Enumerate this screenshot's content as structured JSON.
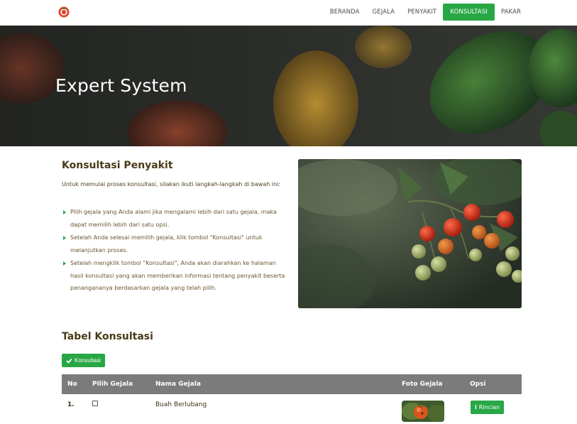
{
  "nav": {
    "items": [
      {
        "label": "BERANDA",
        "active": false
      },
      {
        "label": "GEJALA",
        "active": false
      },
      {
        "label": "PENYAKIT",
        "active": false
      },
      {
        "label": "KONSULTASI",
        "active": true
      },
      {
        "label": "PAKAR",
        "active": false
      }
    ]
  },
  "hero": {
    "title": "Expert System"
  },
  "konsultasi": {
    "title": "Konsultasi Penyakit",
    "intro": "Untuk memulai proses konsultasi, silakan ikuti langkah-langkah di bawah ini:",
    "steps": [
      "Pilih gejala yang Anda alami jika mengalami lebih dari satu gejala, maka dapat memilih lebih dari satu opsi.",
      "Setelah Anda selesai memilih gejala, klik tombol \"Konsultasi\" untuk melanjutkan proses.",
      "Setelah mengklik tombol \"Konsultasi\", Anda akan diarahkan ke halaman hasil konsultasi yang akan memberikan informasi tentang penyakit beserta penangananya berdasarkan gejala yang telah pilih."
    ]
  },
  "table": {
    "title": "Tabel Konsultasi",
    "button_label": "Konsultasi",
    "headers": [
      "No",
      "Pilih Gejala",
      "Nama Gejala",
      "Foto Gejala",
      "Opsi"
    ],
    "rows": [
      {
        "no": "1.",
        "checked": false,
        "nama": "Buah Berlubang",
        "opsi_label": "Rincian"
      }
    ]
  },
  "colors": {
    "accent": "#28a745",
    "table_header": "#7b7b7b",
    "heading": "#4a3a18"
  },
  "icons": {
    "logo": "tomato-logo-icon",
    "konsultasi_button": "check-icon",
    "rincian_button": "info-icon"
  }
}
